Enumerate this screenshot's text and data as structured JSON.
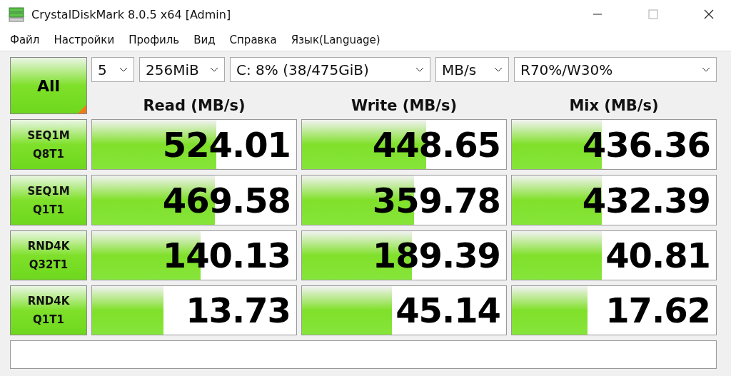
{
  "window": {
    "title": "CrystalDiskMark 8.0.5 x64 [Admin]"
  },
  "menu": [
    "Файл",
    "Настройки",
    "Профиль",
    "Вид",
    "Справка",
    "Язык(Language)"
  ],
  "all_button": "All",
  "selectors": [
    {
      "value": "5"
    },
    {
      "value": "256MiB"
    },
    {
      "value": "C: 8% (38/475GiB)"
    },
    {
      "value": "MB/s"
    },
    {
      "value": "R70%/W30%"
    }
  ],
  "columns": [
    "Read (MB/s)",
    "Write (MB/s)",
    "Mix (MB/s)"
  ],
  "rows": [
    {
      "test": [
        "SEQ1M",
        "Q8T1"
      ],
      "results": [
        {
          "value": "524.01",
          "level": 0.61
        },
        {
          "value": "448.65",
          "level": 0.61
        },
        {
          "value": "436.36",
          "level": 0.44
        }
      ]
    },
    {
      "test": [
        "SEQ1M",
        "Q1T1"
      ],
      "results": [
        {
          "value": "469.58",
          "level": 0.6
        },
        {
          "value": "359.78",
          "level": 0.55
        },
        {
          "value": "432.39",
          "level": 0.44
        }
      ]
    },
    {
      "test": [
        "RND4K",
        "Q32T1"
      ],
      "results": [
        {
          "value": "140.13",
          "level": 0.53
        },
        {
          "value": "189.39",
          "level": 0.54
        },
        {
          "value": "40.81",
          "level": 0.44
        }
      ]
    },
    {
      "test": [
        "RND4K",
        "Q1T1"
      ],
      "results": [
        {
          "value": "13.73",
          "level": 0.35
        },
        {
          "value": "45.14",
          "level": 0.44
        },
        {
          "value": "17.62",
          "level": 0.37
        }
      ]
    }
  ]
}
